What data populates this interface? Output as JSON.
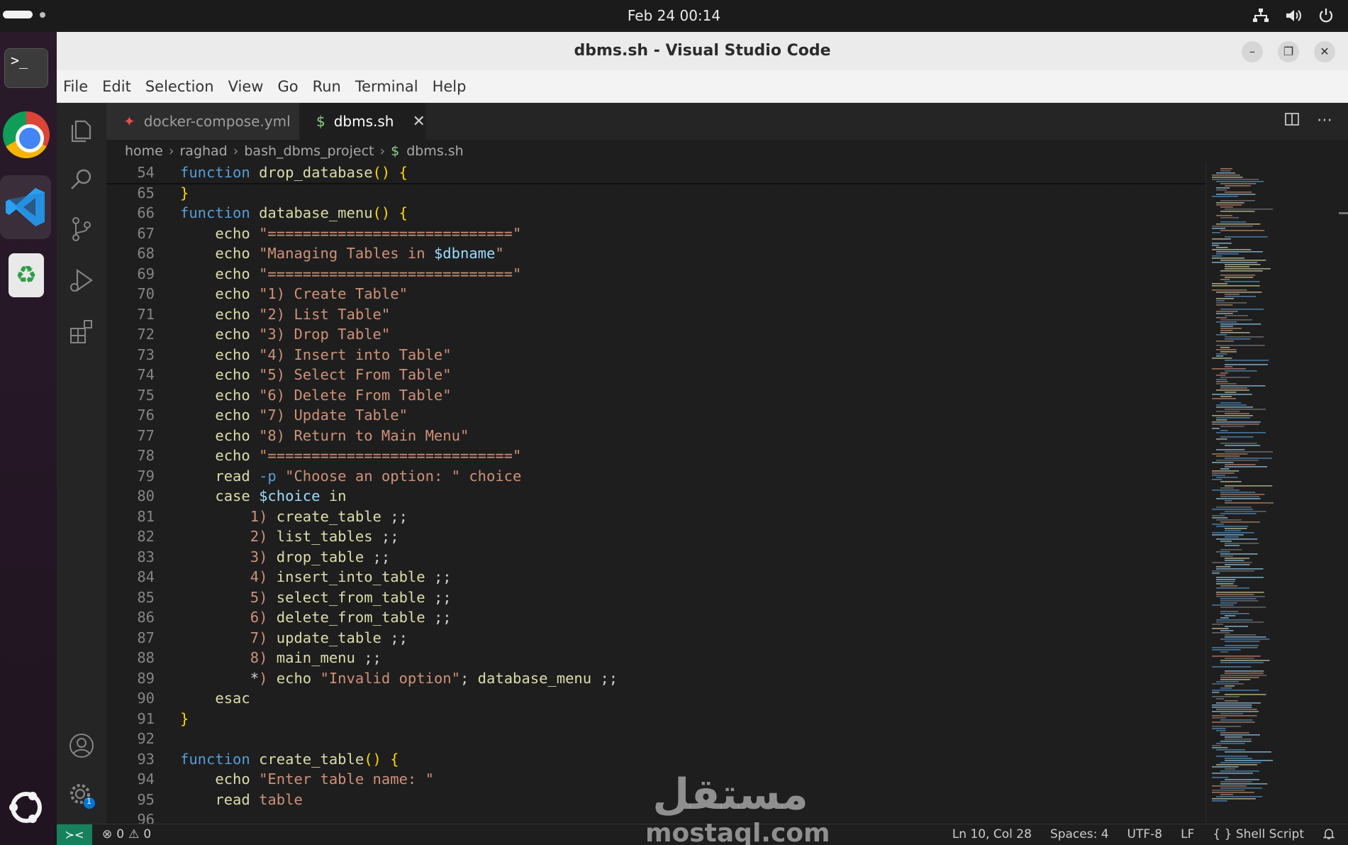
{
  "system": {
    "clock": "Feb 24  00:14"
  },
  "dock": {
    "items": [
      "terminal",
      "google-chrome",
      "visual-studio-code",
      "trash",
      "show-apps"
    ]
  },
  "window": {
    "title": "dbms.sh - Visual Studio Code",
    "controls": [
      "–",
      "❐",
      "✕"
    ]
  },
  "menu": [
    "File",
    "Edit",
    "Selection",
    "View",
    "Go",
    "Run",
    "Terminal",
    "Help"
  ],
  "tabs": [
    {
      "label": "docker-compose.yml",
      "icon": "yaml-icon",
      "active": false
    },
    {
      "label": "dbms.sh",
      "icon": "$",
      "active": true,
      "close": "✕"
    }
  ],
  "breadcrumb": [
    "home",
    "raghad",
    "bash_dbms_project",
    "dbms.sh"
  ],
  "editor": {
    "lines": [
      {
        "n": "54",
        "tokens": [
          [
            "kw",
            "function"
          ],
          [
            "",
            " "
          ],
          [
            "fn",
            "drop_database"
          ],
          [
            "br1",
            "()"
          ],
          [
            "",
            " "
          ],
          [
            "br1",
            "{"
          ]
        ]
      },
      {
        "n": "65",
        "tokens": [
          [
            "br1",
            "}"
          ]
        ]
      },
      {
        "n": "66",
        "tokens": [
          [
            "kw",
            "function"
          ],
          [
            "",
            " "
          ],
          [
            "fn",
            "database_menu"
          ],
          [
            "br1",
            "()"
          ],
          [
            "",
            " "
          ],
          [
            "br1",
            "{"
          ]
        ]
      },
      {
        "n": "67",
        "tokens": [
          [
            "",
            "    "
          ],
          [
            "fn",
            "echo"
          ],
          [
            "",
            " "
          ],
          [
            "str",
            "\"============================\""
          ]
        ]
      },
      {
        "n": "68",
        "tokens": [
          [
            "",
            "    "
          ],
          [
            "fn",
            "echo"
          ],
          [
            "",
            " "
          ],
          [
            "str",
            "\"Managing Tables in "
          ],
          [
            "var",
            "$dbname"
          ],
          [
            "str",
            "\""
          ]
        ]
      },
      {
        "n": "69",
        "tokens": [
          [
            "",
            "    "
          ],
          [
            "fn",
            "echo"
          ],
          [
            "",
            " "
          ],
          [
            "str",
            "\"============================\""
          ]
        ]
      },
      {
        "n": "70",
        "tokens": [
          [
            "",
            "    "
          ],
          [
            "fn",
            "echo"
          ],
          [
            "",
            " "
          ],
          [
            "str",
            "\"1) Create Table\""
          ]
        ]
      },
      {
        "n": "71",
        "tokens": [
          [
            "",
            "    "
          ],
          [
            "fn",
            "echo"
          ],
          [
            "",
            " "
          ],
          [
            "str",
            "\"2) List Table\""
          ]
        ]
      },
      {
        "n": "72",
        "tokens": [
          [
            "",
            "    "
          ],
          [
            "fn",
            "echo"
          ],
          [
            "",
            " "
          ],
          [
            "str",
            "\"3) Drop Table\""
          ]
        ]
      },
      {
        "n": "73",
        "tokens": [
          [
            "",
            "    "
          ],
          [
            "fn",
            "echo"
          ],
          [
            "",
            " "
          ],
          [
            "str",
            "\"4) Insert into Table\""
          ]
        ]
      },
      {
        "n": "74",
        "tokens": [
          [
            "",
            "    "
          ],
          [
            "fn",
            "echo"
          ],
          [
            "",
            " "
          ],
          [
            "str",
            "\"5) Select From Table\""
          ]
        ]
      },
      {
        "n": "75",
        "tokens": [
          [
            "",
            "    "
          ],
          [
            "fn",
            "echo"
          ],
          [
            "",
            " "
          ],
          [
            "str",
            "\"6) Delete From Table\""
          ]
        ]
      },
      {
        "n": "76",
        "tokens": [
          [
            "",
            "    "
          ],
          [
            "fn",
            "echo"
          ],
          [
            "",
            " "
          ],
          [
            "str",
            "\"7) Update Table\""
          ]
        ]
      },
      {
        "n": "77",
        "tokens": [
          [
            "",
            "    "
          ],
          [
            "fn",
            "echo"
          ],
          [
            "",
            " "
          ],
          [
            "str",
            "\"8) Return to Main Menu\""
          ]
        ]
      },
      {
        "n": "78",
        "tokens": [
          [
            "",
            "    "
          ],
          [
            "fn",
            "echo"
          ],
          [
            "",
            " "
          ],
          [
            "str",
            "\"============================\""
          ]
        ]
      },
      {
        "n": "79",
        "tokens": [
          [
            "",
            "    "
          ],
          [
            "fn",
            "read"
          ],
          [
            "",
            " "
          ],
          [
            "flag",
            "-p"
          ],
          [
            "",
            " "
          ],
          [
            "str",
            "\"Choose an option: \""
          ],
          [
            "",
            " "
          ],
          [
            "str",
            "choice"
          ]
        ]
      },
      {
        "n": "80",
        "tokens": [
          [
            "",
            "    "
          ],
          [
            "fn",
            "case"
          ],
          [
            "",
            " "
          ],
          [
            "var",
            "$choice"
          ],
          [
            "",
            " "
          ],
          [
            "fn",
            "in"
          ]
        ]
      },
      {
        "n": "81",
        "tokens": [
          [
            "",
            "        "
          ],
          [
            "num",
            "1)"
          ],
          [
            "",
            " "
          ],
          [
            "fn",
            "create_table"
          ],
          [
            "",
            " ;;"
          ]
        ]
      },
      {
        "n": "82",
        "tokens": [
          [
            "",
            "        "
          ],
          [
            "num",
            "2)"
          ],
          [
            "",
            " "
          ],
          [
            "fn",
            "list_tables"
          ],
          [
            "",
            " ;;"
          ]
        ]
      },
      {
        "n": "83",
        "tokens": [
          [
            "",
            "        "
          ],
          [
            "num",
            "3)"
          ],
          [
            "",
            " "
          ],
          [
            "fn",
            "drop_table"
          ],
          [
            "",
            " ;;"
          ]
        ]
      },
      {
        "n": "84",
        "tokens": [
          [
            "",
            "        "
          ],
          [
            "num",
            "4)"
          ],
          [
            "",
            " "
          ],
          [
            "fn",
            "insert_into_table"
          ],
          [
            "",
            " ;;"
          ]
        ]
      },
      {
        "n": "85",
        "tokens": [
          [
            "",
            "        "
          ],
          [
            "num",
            "5)"
          ],
          [
            "",
            " "
          ],
          [
            "fn",
            "select_from_table"
          ],
          [
            "",
            " ;;"
          ]
        ]
      },
      {
        "n": "86",
        "tokens": [
          [
            "",
            "        "
          ],
          [
            "num",
            "6)"
          ],
          [
            "",
            " "
          ],
          [
            "fn",
            "delete_from_table"
          ],
          [
            "",
            " ;;"
          ]
        ]
      },
      {
        "n": "87",
        "tokens": [
          [
            "",
            "        "
          ],
          [
            "num",
            "7)"
          ],
          [
            "",
            " "
          ],
          [
            "fn",
            "update_table"
          ],
          [
            "",
            " ;;"
          ]
        ]
      },
      {
        "n": "88",
        "tokens": [
          [
            "",
            "        "
          ],
          [
            "num",
            "8)"
          ],
          [
            "",
            " "
          ],
          [
            "fn",
            "main_menu"
          ],
          [
            "",
            " ;;"
          ]
        ]
      },
      {
        "n": "89",
        "tokens": [
          [
            "",
            "        "
          ],
          [
            "",
            "*"
          ],
          [
            "num",
            ")"
          ],
          [
            "",
            " "
          ],
          [
            "fn",
            "echo"
          ],
          [
            "",
            " "
          ],
          [
            "str",
            "\"Invalid option\""
          ],
          [
            "",
            "; "
          ],
          [
            "fn",
            "database_menu"
          ],
          [
            "",
            " ;;"
          ]
        ]
      },
      {
        "n": "90",
        "tokens": [
          [
            "",
            "    "
          ],
          [
            "fn",
            "esac"
          ]
        ]
      },
      {
        "n": "91",
        "tokens": [
          [
            "br1",
            "}"
          ]
        ]
      },
      {
        "n": "92",
        "tokens": []
      },
      {
        "n": "93",
        "tokens": [
          [
            "kw",
            "function"
          ],
          [
            "",
            " "
          ],
          [
            "fn",
            "create_table"
          ],
          [
            "br1",
            "()"
          ],
          [
            "",
            " "
          ],
          [
            "br1",
            "{"
          ]
        ]
      },
      {
        "n": "94",
        "tokens": [
          [
            "",
            "    "
          ],
          [
            "fn",
            "echo"
          ],
          [
            "",
            " "
          ],
          [
            "str",
            "\"Enter table name: \""
          ]
        ]
      },
      {
        "n": "95",
        "tokens": [
          [
            "",
            "    "
          ],
          [
            "fn",
            "read"
          ],
          [
            "",
            " "
          ],
          [
            "str",
            "table"
          ]
        ]
      },
      {
        "n": "96",
        "tokens": []
      }
    ]
  },
  "statusbar": {
    "remote_icon": "remote-icon",
    "errors": "0",
    "warnings": "0",
    "position": "Ln 10, Col 28",
    "spaces": "Spaces: 4",
    "encoding": "UTF-8",
    "eol": "LF",
    "language": "Shell Script",
    "notifications_badge": "1"
  },
  "watermark": {
    "arabic": "مستقل",
    "latin": "mostaql.com"
  },
  "colors": {
    "keyword": "#569cd6",
    "function": "#dcdcaa",
    "string": "#ce9178",
    "variable": "#9cdcfe",
    "bracket": "#ffd700",
    "editor_bg": "#1e1e1e",
    "remote_bg": "#16825d"
  }
}
